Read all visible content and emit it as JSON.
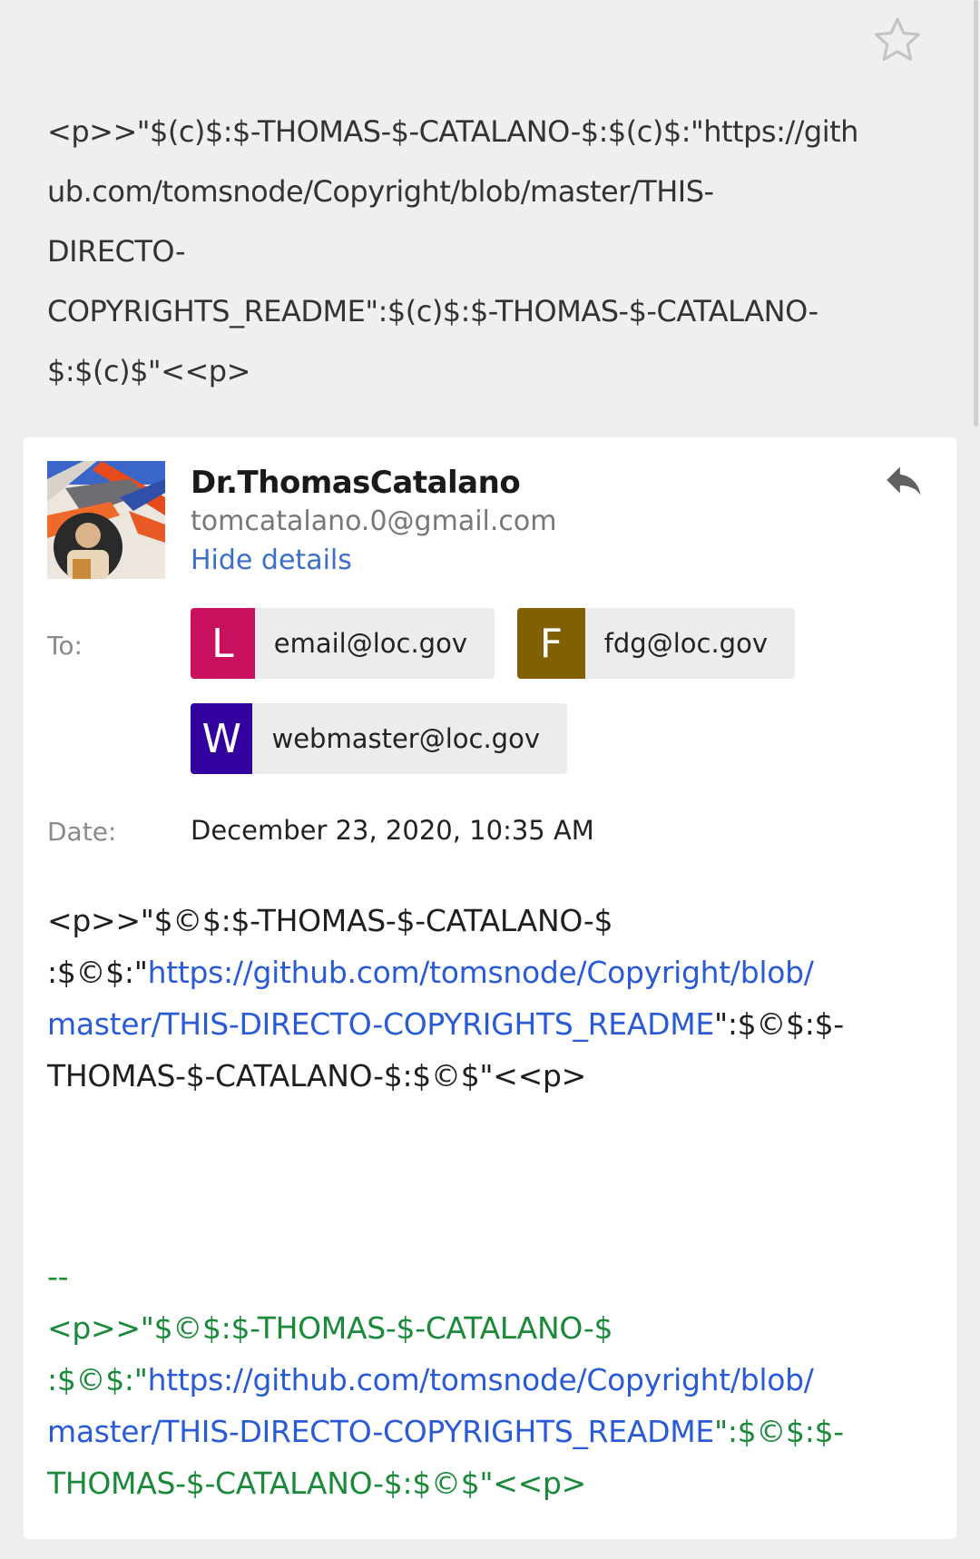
{
  "subject": {
    "line1": "<p>>\"$(c)$:$-THOMAS-$-CATALANO-$:$(c)$:\"https://gith",
    "line2": "ub.com/tomsnode/Copyright/blob/master/THIS-",
    "line3": "DIRECTO-",
    "line4": "COPYRIGHTS_README\":$(c)$:$-THOMAS-$-CATALANO-",
    "line5": "$:$(c)$\"<<p>"
  },
  "header": {
    "star_icon": "star-outline-icon",
    "reply_icon": "reply-icon"
  },
  "sender": {
    "name": "Dr.ThomasCatalano",
    "email": "tomcatalano.0@gmail.com",
    "hide_details": "Hide details"
  },
  "details": {
    "to_label": "To:",
    "date_label": "Date:",
    "date_value": "December 23, 2020, 10:35 AM",
    "recipients": [
      {
        "letter": "L",
        "email": "email@loc.gov",
        "color": "#c8105e"
      },
      {
        "letter": "F",
        "email": "fdg@loc.gov",
        "color": "#806000"
      },
      {
        "letter": "W",
        "email": "webmaster@loc.gov",
        "color": "#3300a0"
      }
    ]
  },
  "body": {
    "line1": "<p>>\"$©$:$-THOMAS-$-CATALANO-$",
    "line2_prefix": ":$©$:\"",
    "link_part1": "https://github.com/tomsnode/Copyright/blob/",
    "link_part2": "master/THIS-DIRECTO-COPYRIGHTS_README",
    "line3_suffix": "\":$©$:$-",
    "line4": "THOMAS-$-CATALANO-$:$©$\"<<p>"
  },
  "signature": {
    "separator": "--",
    "line1": "<p>>\"$©$:$-THOMAS-$-CATALANO-$",
    "line2_prefix": ":$©$:\"",
    "link_part1": "https://github.com/tomsnode/Copyright/blob/",
    "link_part2": "master/THIS-DIRECTO-COPYRIGHTS_README",
    "line3_suffix": "\":$©$:$-",
    "line4": "THOMAS-$-CATALANO-$:$©$\"<<p>"
  },
  "colors": {
    "link": "#2a5bd7",
    "signature": "#1a8a3a",
    "hide_details": "#3b6fc8"
  }
}
